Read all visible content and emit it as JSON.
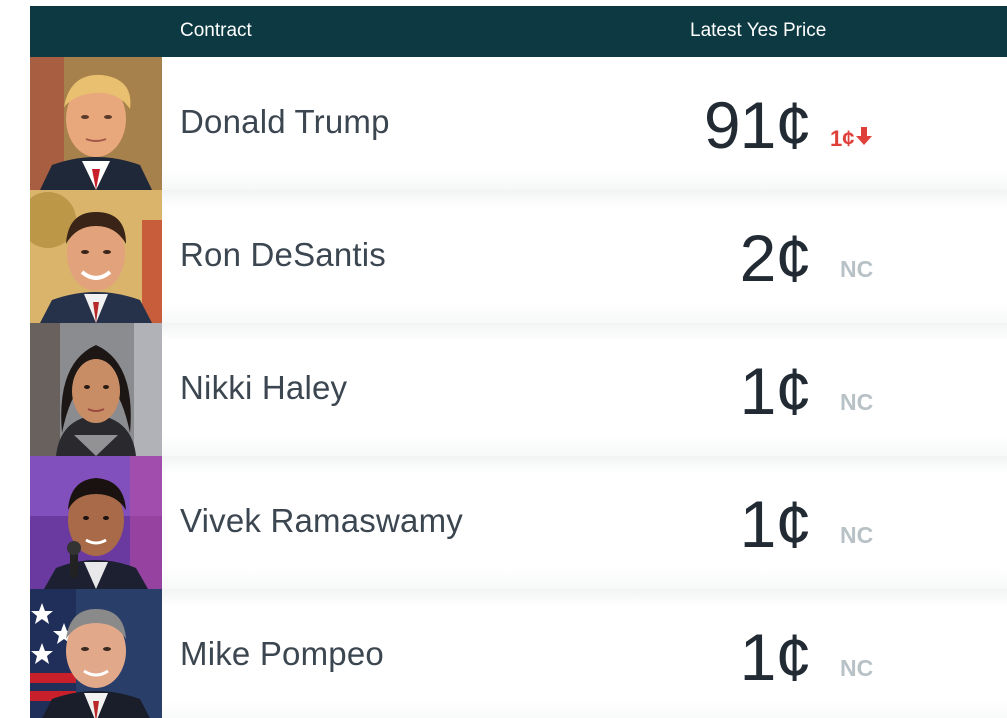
{
  "header": {
    "contract_label": "Contract",
    "price_label": "Latest Yes Price"
  },
  "colors": {
    "header_bg": "#0d3a42",
    "down": "#e0403a",
    "no_change": "#b7c1c6"
  },
  "contracts": [
    {
      "name": "Donald Trump",
      "price": "91¢",
      "change": "1¢",
      "change_dir": "down",
      "photo_icon": "portrait-photo"
    },
    {
      "name": "Ron DeSantis",
      "price": "2¢",
      "change": "NC",
      "change_dir": "none",
      "photo_icon": "portrait-photo"
    },
    {
      "name": "Nikki Haley",
      "price": "1¢",
      "change": "NC",
      "change_dir": "none",
      "photo_icon": "portrait-photo"
    },
    {
      "name": "Vivek Ramaswamy",
      "price": "1¢",
      "change": "NC",
      "change_dir": "none",
      "photo_icon": "portrait-photo"
    },
    {
      "name": "Mike Pompeo",
      "price": "1¢",
      "change": "NC",
      "change_dir": "none",
      "photo_icon": "portrait-photo"
    }
  ]
}
